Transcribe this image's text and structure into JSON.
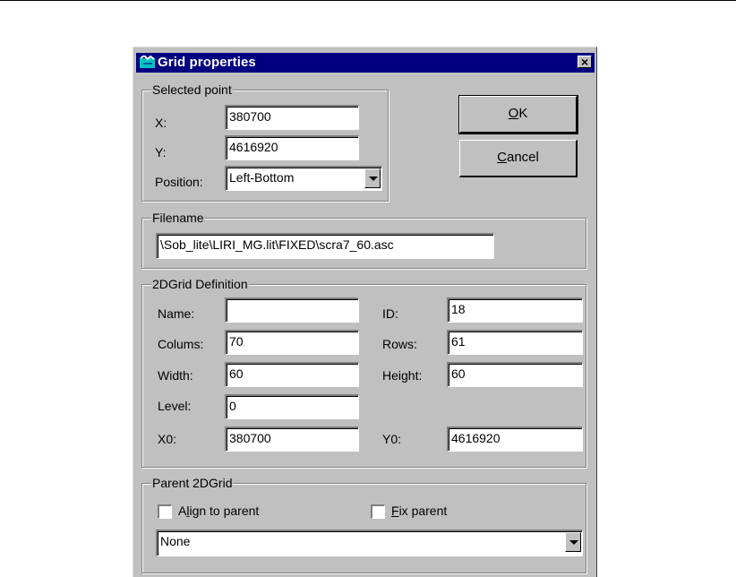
{
  "dialog": {
    "title": "Grid properties",
    "close_glyph": "×",
    "icon": "grid-window-icon"
  },
  "selected_point": {
    "label": "Selected point",
    "x_label": "X:",
    "x_value": "380700",
    "y_label": "Y:",
    "y_value": "4616920",
    "position_label": "Position:",
    "position_value": "Left-Bottom"
  },
  "buttons": {
    "ok_prefix": "",
    "ok_mnemonic": "O",
    "ok_suffix": "K",
    "cancel_prefix": "",
    "cancel_mnemonic": "C",
    "cancel_suffix": "ancel"
  },
  "filename": {
    "label": "Filename",
    "value": "\\Sob_lite\\LIRI_MG.lit\\FIXED\\scra7_60.asc"
  },
  "grid_def": {
    "label": "2DGrid Definition",
    "name_label": "Name:",
    "name_value": "",
    "id_label": "ID:",
    "id_value": "18",
    "columns_label": "Colums:",
    "columns_value": "70",
    "rows_label": "Rows:",
    "rows_value": "61",
    "width_label": "Width:",
    "width_value": "60",
    "height_label": "Height:",
    "height_value": "60",
    "level_label": "Level:",
    "level_value": "0",
    "x0_label": "X0:",
    "x0_value": "380700",
    "y0_label": "Y0:",
    "y0_value": "4616920"
  },
  "parent": {
    "label": "Parent 2DGrid",
    "align_prefix": "A",
    "align_mnemonic": "l",
    "align_suffix": "ign to parent",
    "align_checked": false,
    "fix_prefix": "",
    "fix_mnemonic": "F",
    "fix_suffix": "ix parent",
    "fix_checked": false,
    "select_value": "None"
  }
}
